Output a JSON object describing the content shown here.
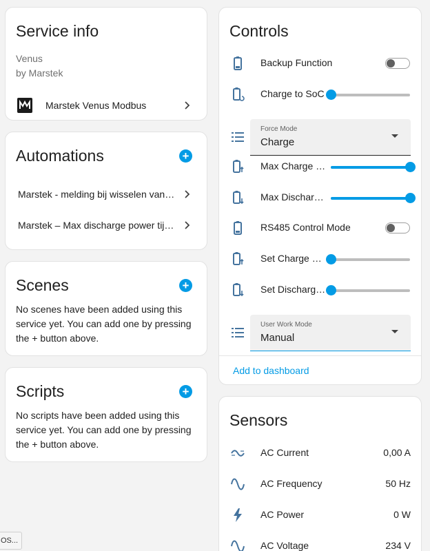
{
  "service_info": {
    "title": "Service info",
    "model": "Venus",
    "manufacturer": "by Marstek",
    "integration_name": "Marstek Venus Modbus",
    "logo_icon": "marstek-logo"
  },
  "automations": {
    "title": "Automations",
    "items": [
      {
        "label": "Marstek - melding bij wisselen van anti..."
      },
      {
        "label": "Marstek – Max discharge power tijdsc..."
      }
    ]
  },
  "scenes": {
    "title": "Scenes",
    "empty_text": "No scenes have been added using this service yet. You can add one by pressing the + button above."
  },
  "scripts": {
    "title": "Scripts",
    "empty_text": "No scripts have been added using this service yet. You can add one by pressing the + button above."
  },
  "controls": {
    "title": "Controls",
    "backup_function": {
      "label": "Backup Function",
      "state": "off",
      "icon": "battery-icon"
    },
    "charge_to_soc": {
      "label": "Charge to SoC",
      "value_fraction": 0.0,
      "icon": "battery-sync-icon"
    },
    "force_mode": {
      "label": "Force Mode",
      "value": "Charge",
      "icon": "list-icon"
    },
    "max_charge_power": {
      "label": "Max Charge P...",
      "value_fraction": 1.0,
      "icon": "battery-charge-icon"
    },
    "max_discharge_power": {
      "label": "Max Discharg...",
      "value_fraction": 1.0,
      "icon": "battery-discharge-icon"
    },
    "rs485_control_mode": {
      "label": "RS485 Control Mode",
      "state": "off",
      "icon": "battery-icon"
    },
    "set_charge_power": {
      "label": "Set Charge Po...",
      "value_fraction": 0.0,
      "icon": "battery-charge-icon"
    },
    "set_discharge_power": {
      "label": "Set Discharge ...",
      "value_fraction": 0.0,
      "icon": "battery-discharge-icon"
    },
    "user_work_mode": {
      "label": "User Work Mode",
      "value": "Manual",
      "icon": "list-icon"
    },
    "add_to_dashboard": "Add to dashboard"
  },
  "sensors": {
    "title": "Sensors",
    "items": [
      {
        "label": "AC Current",
        "value": "0,00 A",
        "icon": "current-ac-icon"
      },
      {
        "label": "AC Frequency",
        "value": "50 Hz",
        "icon": "sine-wave-icon"
      },
      {
        "label": "AC Power",
        "value": "0 W",
        "icon": "lightning-bolt-icon"
      },
      {
        "label": "AC Voltage",
        "value": "234 V",
        "icon": "sine-wave-icon"
      }
    ]
  },
  "tooltip_text": "OS...",
  "colors": {
    "accent": "#039be5",
    "icon": "#44739e",
    "background": "#f3f3f3",
    "card": "#ffffff"
  }
}
